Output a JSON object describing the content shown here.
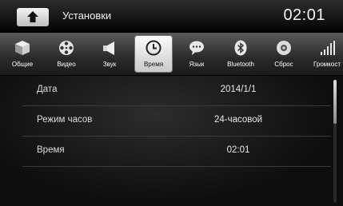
{
  "header": {
    "title": "Установки",
    "time": "02:01"
  },
  "tabs": [
    {
      "label": "Общие",
      "icon": "box-icon"
    },
    {
      "label": "Видео",
      "icon": "film-reel-icon"
    },
    {
      "label": "Звук",
      "icon": "speaker-icon"
    },
    {
      "label": "Время",
      "icon": "clock-icon",
      "selected": true
    },
    {
      "label": "Язык",
      "icon": "speech-bubble-icon"
    },
    {
      "label": "Bluetooth",
      "icon": "bluetooth-icon"
    },
    {
      "label": "Сброс",
      "icon": "disc-icon"
    },
    {
      "label": "Громкост",
      "icon": "volume-bars-icon"
    }
  ],
  "settings": {
    "date": {
      "label": "Дата",
      "value": "2014/1/1"
    },
    "clock_mode": {
      "label": "Режим часов",
      "value": "24-часовой"
    },
    "time": {
      "label": "Время",
      "value": "02:01"
    }
  }
}
